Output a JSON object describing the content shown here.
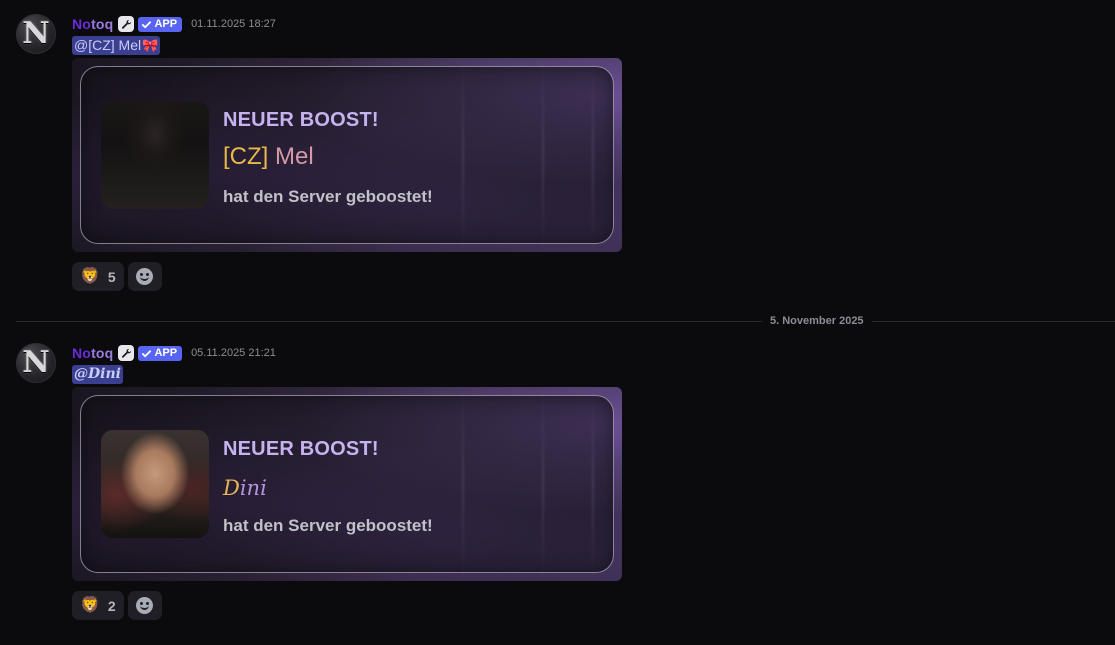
{
  "messages": [
    {
      "username": "Notoq",
      "username_parts": [
        "No",
        "toq"
      ],
      "app_badge": "APP",
      "timestamp": "01.11.2025 18:27",
      "mention": "@[CZ] Mel",
      "mention_emoji": "🎀",
      "embed": {
        "title": "NEUER BOOST!",
        "name_prefix": "[CZ]",
        "name_rest": " Mel",
        "subtitle": "hat den Server geboostet!"
      },
      "reaction": {
        "emoji": "🦁",
        "count": "5"
      }
    },
    {
      "username": "Notoq",
      "username_parts": [
        "No",
        "toq"
      ],
      "app_badge": "APP",
      "timestamp": "05.11.2025 21:21",
      "mention": "@Dini",
      "embed": {
        "title": "NEUER BOOST!",
        "name_prefix": "D",
        "name_rest": "ini",
        "subtitle": "hat den Server geboostet!"
      },
      "reaction": {
        "emoji": "🦁",
        "count": "2"
      }
    }
  ],
  "date_divider": "5. November 2025",
  "avatar_letter": "N",
  "icons": {
    "role": "wrench-icon",
    "verified": "checkmark-icon",
    "add_reaction": "smiley-add-reaction-icon"
  },
  "colors": {
    "app_badge": "#5865f2",
    "mention_bg": "#3a3f8f",
    "embed_title": "#c5b2ee",
    "name_gold": "#e9b84a"
  }
}
